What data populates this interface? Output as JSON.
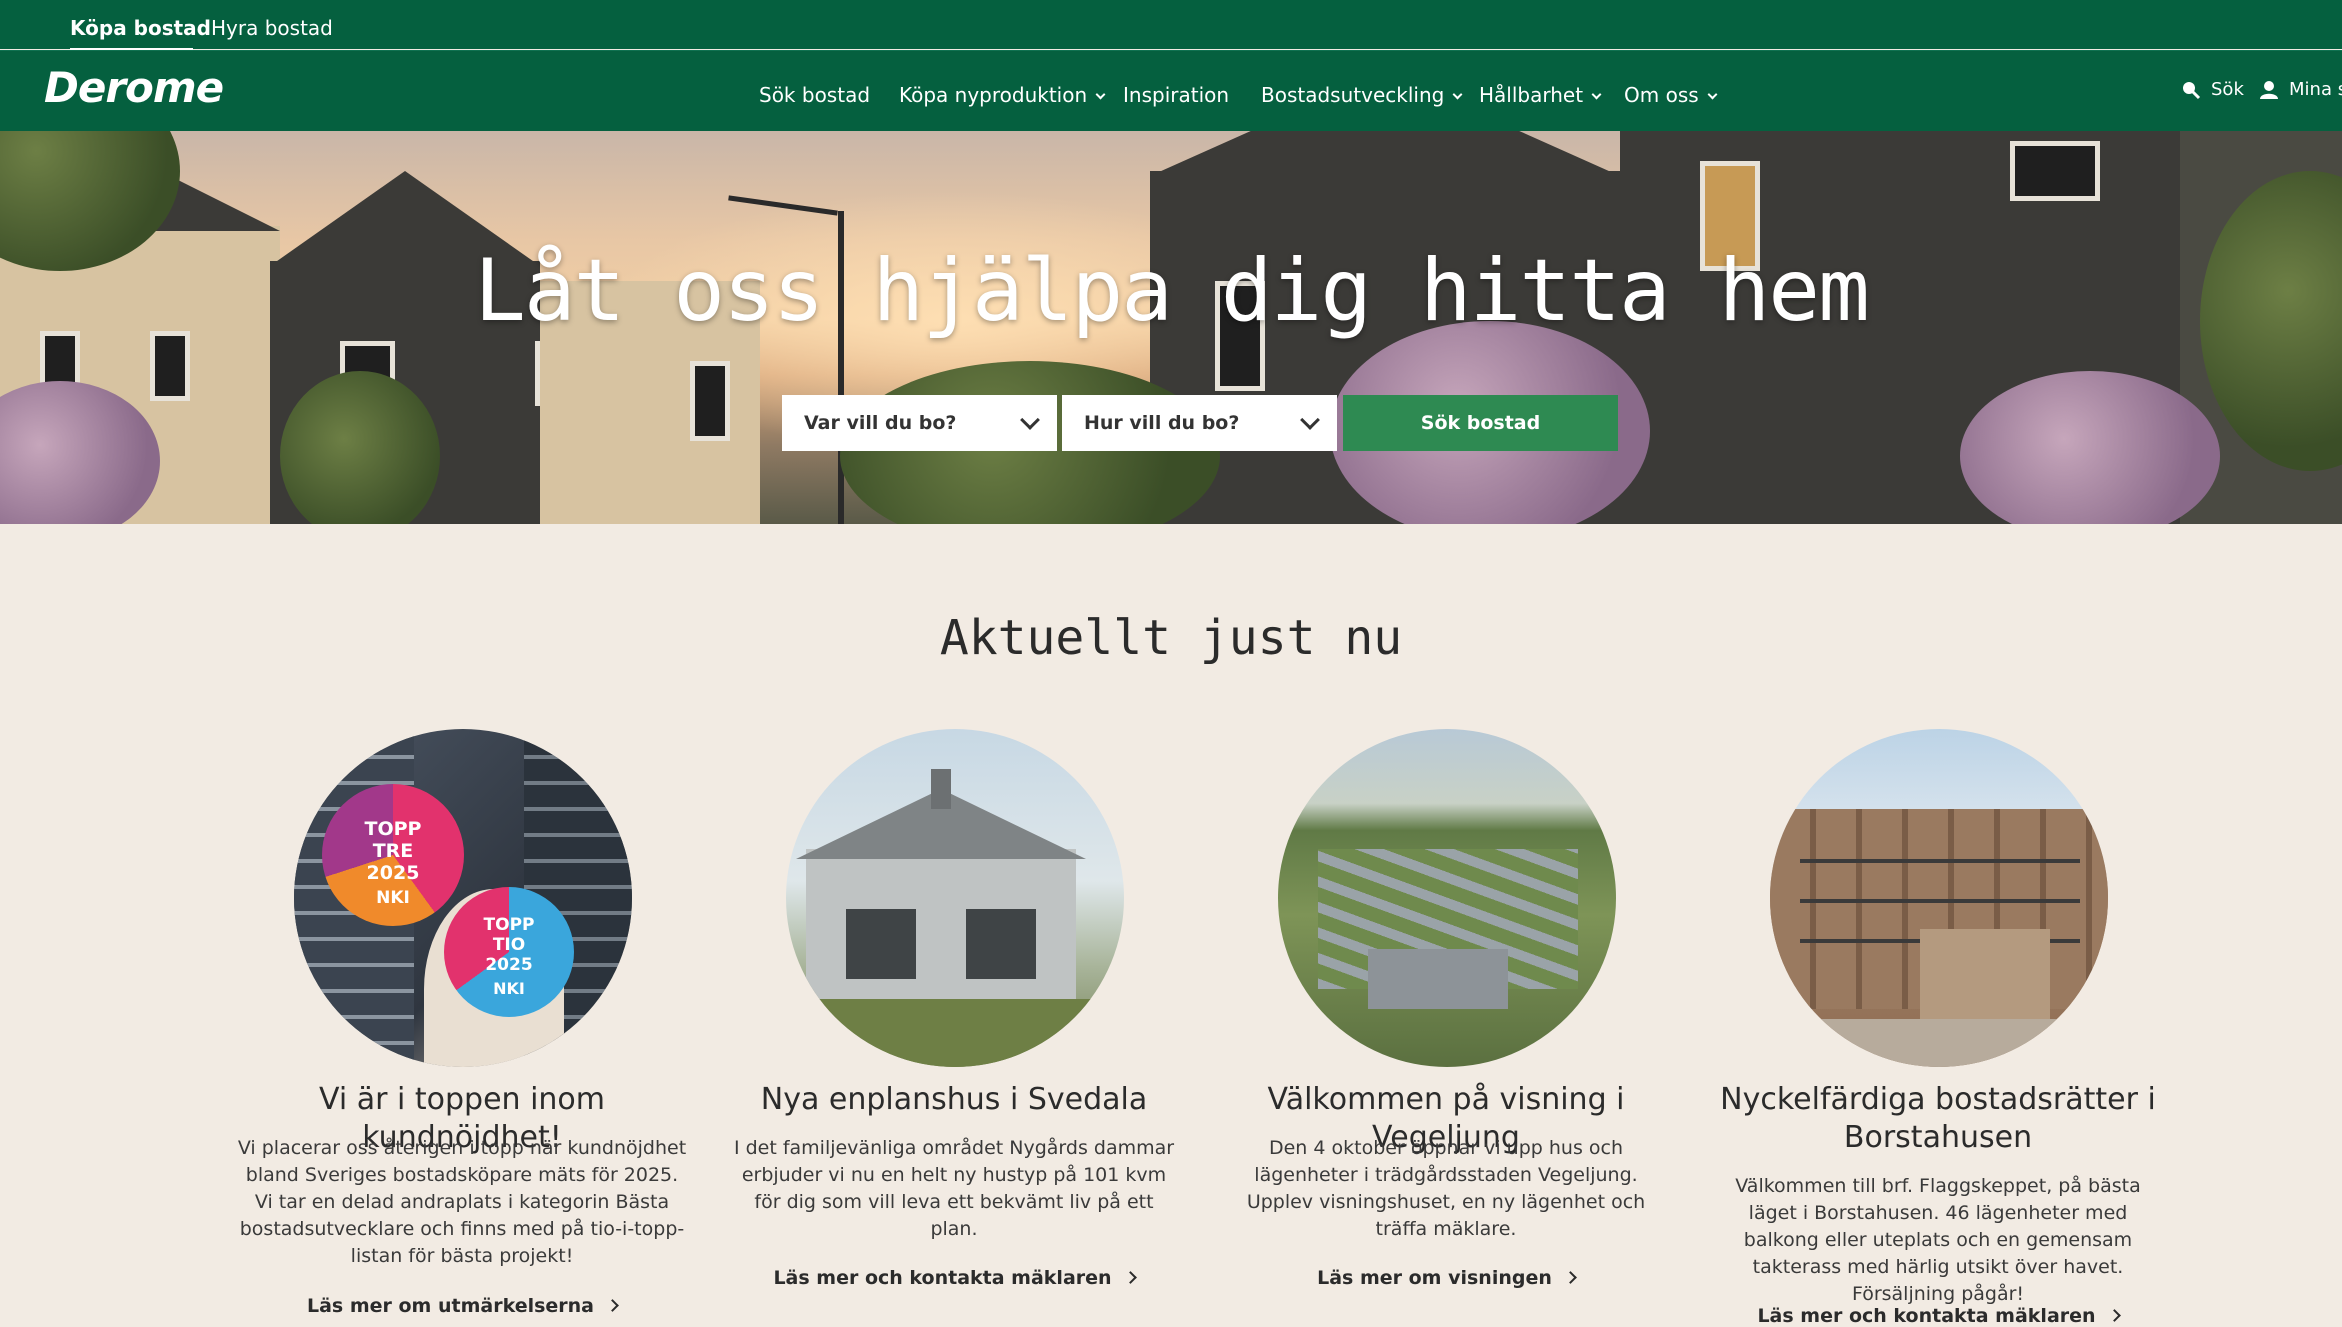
{
  "top_tabs": [
    {
      "label": "Köpa bostad",
      "active": true
    },
    {
      "label": "Hyra bostad",
      "active": false
    }
  ],
  "nav": {
    "logo": "Derome",
    "items": [
      {
        "label": "Sök bostad",
        "dropdown": false
      },
      {
        "label": "Köpa nyproduktion",
        "dropdown": true
      },
      {
        "label": "Inspiration",
        "dropdown": false
      },
      {
        "label": "Bostadsutveckling",
        "dropdown": true
      },
      {
        "label": "Hållbarhet",
        "dropdown": true
      },
      {
        "label": "Om oss",
        "dropdown": true
      }
    ],
    "search_label": "Sök",
    "account_label": "Mina si"
  },
  "hero": {
    "title": "Låt oss hjälpa dig hitta hem",
    "where_placeholder": "Var vill du bo?",
    "how_placeholder": "Hur vill du bo?",
    "search_button": "Sök bostad"
  },
  "section": {
    "title": "Aktuellt just nu",
    "cards": [
      {
        "title": "Vi är i toppen inom kundnöjdhet!",
        "body": "Vi placerar oss återigen i topp när kundnöjdhet bland Sveriges bostadsköpare mäts för 2025. Vi tar en delad andraplats i kategorin Bästa bostadsutvecklare och finns med på tio-i-topp-listan för bästa projekt!",
        "link": "Läs mer om utmärkelserna",
        "badges": [
          {
            "line1": "TOPP",
            "line2": "TRE",
            "line3": "2025",
            "line4": "NKI"
          },
          {
            "line1": "TOPP",
            "line2": "TIO",
            "line3": "2025",
            "line4": "NKI"
          }
        ]
      },
      {
        "title": "Nya enplanshus i Svedala",
        "body": "I det familjevänliga området Nygårds dammar erbjuder vi nu en helt ny hustyp på 101 kvm för dig som vill leva ett bekvämt liv på ett plan.",
        "link": "Läs mer och kontakta mäklaren"
      },
      {
        "title": "Välkommen på visning i Vegeljung",
        "body": "Den 4 oktober öppnar vi upp hus och lägenheter i trädgårdsstaden Vegeljung. Upplev visningshuset, en ny lägenhet och träffa mäklare.",
        "link": "Läs mer om visningen"
      },
      {
        "title": "Nyckelfärdiga bostadsrätter i Borstahusen",
        "body": "Välkommen till brf. Flaggskeppet, på bästa läget i Borstahusen. 46 lägenheter med balkong eller uteplats och en gemensam takterass med härlig utsikt över havet. Försäljning pågår!",
        "link": "Läs mer och kontakta mäklaren"
      }
    ]
  },
  "colors": {
    "brand_green": "#05603f",
    "button_green": "#2e8a52",
    "page_bg": "#f2ebe3",
    "badge_pink": "#e0336e",
    "badge_blue": "#3aa6dc"
  }
}
